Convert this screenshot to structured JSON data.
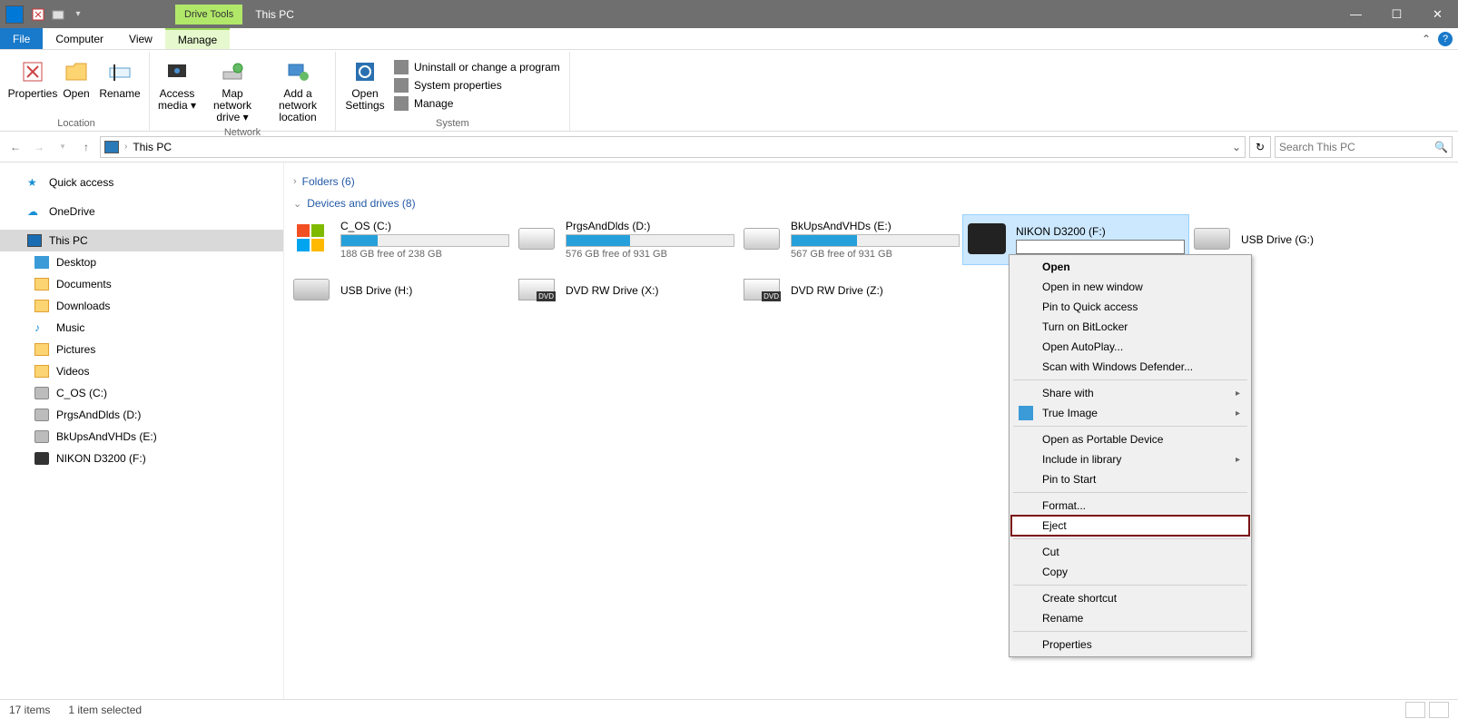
{
  "titlebar": {
    "drive_tools": "Drive Tools",
    "title": "This PC"
  },
  "tabs": {
    "file": "File",
    "computer": "Computer",
    "view": "View",
    "manage": "Manage"
  },
  "ribbon": {
    "properties": "Properties",
    "open": "Open",
    "rename": "Rename",
    "access_media": "Access media ▾",
    "map_drive": "Map network drive ▾",
    "add_net": "Add a network location",
    "open_settings": "Open Settings",
    "uninstall": "Uninstall or change a program",
    "sysprops": "System properties",
    "manage": "Manage",
    "grp_location": "Location",
    "grp_network": "Network",
    "grp_system": "System"
  },
  "addr": {
    "path": "This PC",
    "search_ph": "Search This PC"
  },
  "nav": {
    "quick": "Quick access",
    "onedrive": "OneDrive",
    "thispc": "This PC",
    "desktop": "Desktop",
    "documents": "Documents",
    "downloads": "Downloads",
    "music": "Music",
    "pictures": "Pictures",
    "videos": "Videos",
    "c": "C_OS (C:)",
    "d": "PrgsAndDlds (D:)",
    "e": "BkUpsAndVHDs (E:)",
    "f": "NIKON D3200 (F:)"
  },
  "sections": {
    "folders": "Folders (6)",
    "devices": "Devices and drives (8)"
  },
  "drives": {
    "c": {
      "label": "C_OS (C:)",
      "free": "188 GB free of 238 GB",
      "pct": 22
    },
    "d": {
      "label": "PrgsAndDlds (D:)",
      "free": "576 GB free of 931 GB",
      "pct": 38
    },
    "e": {
      "label": "BkUpsAndVHDs (E:)",
      "free": "567 GB free of 931 GB",
      "pct": 39
    },
    "f": {
      "label": "NIKON D3200 (F:)"
    },
    "g": {
      "label": "USB Drive (G:)"
    },
    "h": {
      "label": "USB Drive (H:)"
    },
    "x": {
      "label": "DVD RW Drive (X:)"
    },
    "z": {
      "label": "DVD RW Drive (Z:)"
    }
  },
  "ctx": {
    "open": "Open",
    "open_new": "Open in new window",
    "pin_qa": "Pin to Quick access",
    "bitlocker": "Turn on BitLocker",
    "autoplay": "Open AutoPlay...",
    "defender": "Scan with Windows Defender...",
    "share": "Share with",
    "trueimage": "True Image",
    "portable": "Open as Portable Device",
    "include": "Include in library",
    "pin_start": "Pin to Start",
    "format": "Format...",
    "eject": "Eject",
    "cut": "Cut",
    "copy": "Copy",
    "shortcut": "Create shortcut",
    "rename": "Rename",
    "properties": "Properties"
  },
  "status": {
    "items": "17 items",
    "selected": "1 item selected"
  }
}
